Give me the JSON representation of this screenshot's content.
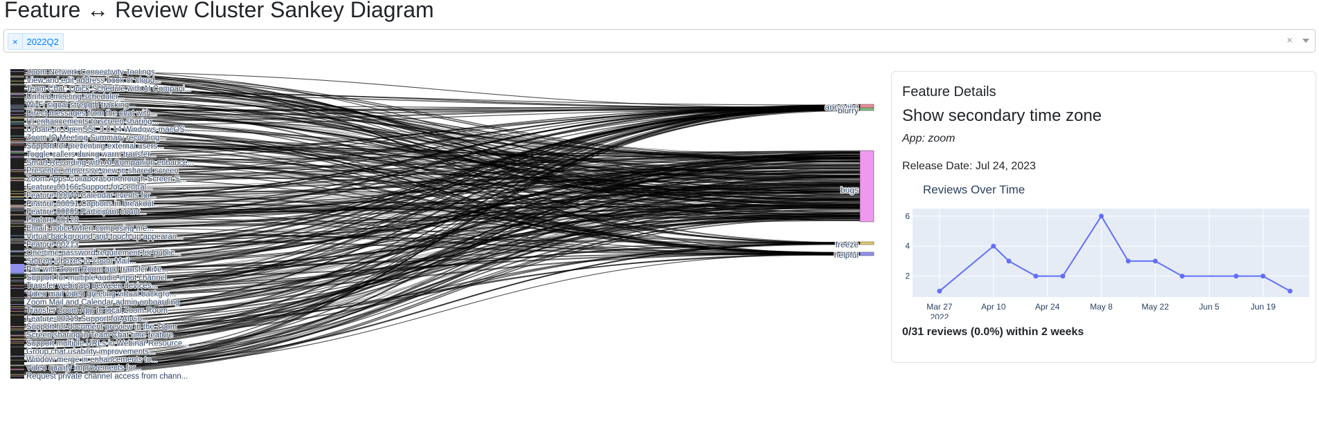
{
  "header": {
    "title": "Feature ↔ Review Cluster Sankey Diagram"
  },
  "filter": {
    "chips": [
      {
        "label": "2022Q2",
        "remove": "×"
      }
    ],
    "clear": "×"
  },
  "sankey": {
    "feature_labels": [
      "Zoom Network Connectivity Toolings",
      "View and edit address book or cloud...",
      "Team Chat: Quick Schedule with AI Compani...",
      "Unified meeting scheduler...",
      "Wi-Fi signal strength tracking...",
      "Direct messages from the chat with...",
      "UI enhancements to screen sharing...",
      "Update to OpenSSL 3.0.14 Windows macOS...",
      "Zoom IQ Meeting Summary recording...",
      "Support for preventing external users...",
      "Toggle callers during warm transfer...",
      "Smart Recording with AI Companion enhance...",
      "Presenter immersive view in shared screen",
      "Zoom Apps Collaboration through Screen S...",
      "Feature-00166 Support for central...",
      "Feature-00044 Calendar events for...",
      "Feature-00091 Captions in breakout...",
      "Feature-00205 Participant count...",
      "Feature-00128",
      "Email: notice when composing me...",
      "Virtual background and touch up appearan...",
      "Feature-00213",
      "One-time password requirement for public...",
      "Shared inboxes in Zoom Mail...",
      "Pair with Zoom Room and transfer live...",
      "Support for multiple audio input channel...",
      "Transfer webinars between devices...",
      "Video mail video greeting virtual backgro...",
      "Zoom Mail and Calendar admin onboarding",
      "Transfer Zoom App to local Zoom Room",
      "Feature-00219 Support for AI Co...",
      "Support for document preview in the Zoom",
      "Screen sharing in Team Chat time feature",
      "Support multiple URLs in Webinar Resource...",
      "Group chat usability improvements...",
      "Window merge in enhancements to...",
      "Video quality improvements for...",
      "Request private channel access from chann..."
    ],
    "clusters": [
      {
        "label": "annoying",
        "color": "#ef8a9a"
      },
      {
        "label": "blurry",
        "color": "#7fbf7f"
      },
      {
        "label": "bugs",
        "color": "#ee99ee"
      },
      {
        "label": "freeze",
        "color": "#e4c96a"
      },
      {
        "label": "helpful",
        "color": "#8f90ee"
      }
    ]
  },
  "details": {
    "heading": "Feature Details",
    "feature_name": "Show secondary time zone",
    "app": "App: zoom",
    "release_date": "Release Date: Jul 24, 2023",
    "summary": "0/31 reviews (0.0%) within 2 weeks",
    "accent_color": "#636efa"
  },
  "chart_data": {
    "type": "line",
    "title": "Reviews Over Time",
    "x": [
      "2022-03-27",
      "2022-04-10",
      "2022-04-14",
      "2022-04-21",
      "2022-04-28",
      "2022-05-08",
      "2022-05-15",
      "2022-05-22",
      "2022-05-29",
      "2022-06-12",
      "2022-06-19",
      "2022-06-26"
    ],
    "y": [
      1,
      4,
      3,
      2,
      2,
      6,
      3,
      3,
      2,
      2,
      2,
      1
    ],
    "x_tick_labels": [
      "Mar 27\n2022",
      "Apr 10",
      "Apr 24",
      "May 8",
      "May 22",
      "Jun 5",
      "Jun 19"
    ],
    "y_tick_labels": [
      "2",
      "4",
      "6"
    ],
    "ylim": [
      0.6,
      6.5
    ],
    "grid": true,
    "line_color": "#636efa",
    "plot_bg": "#e5ecf6"
  }
}
